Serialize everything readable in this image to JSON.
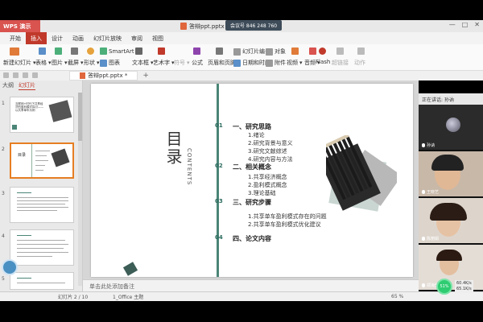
{
  "window": {
    "app_name": "WPS 演示",
    "doc_title": "答辩ppt.pptx",
    "share_label": "会议号 846 248 760",
    "controls": [
      "—",
      "□",
      "✕"
    ]
  },
  "menu": {
    "items": [
      "开始",
      "插入",
      "设计",
      "动画",
      "幻灯片放映",
      "审阅",
      "视图"
    ],
    "active_index": 1
  },
  "ribbon": {
    "new_slide": "新建幻灯片",
    "table": "表格",
    "picture": "图片",
    "screenshot": "截屏",
    "shape": "形状",
    "smartart": "SmartArt",
    "chart": "图表",
    "textbox": "文本框",
    "wordart": "艺术字",
    "symbol": "符号",
    "formula": "公式",
    "header_footer": "页眉和页脚",
    "slide_number": "幻灯片编号",
    "datetime": "日期和时间",
    "object": "对象",
    "attachment": "附件",
    "video": "视频",
    "audio": "音频",
    "flash": "Flash",
    "hyperlink": "超链接",
    "action": "动作"
  },
  "tabstrip": {
    "file_tab": "答辩ppt.pptx *",
    "plus": "+"
  },
  "left_panel": {
    "outline_tab": "大纲",
    "slides_tab": "幻灯片",
    "thumb_numbers": [
      "1",
      "2",
      "3",
      "4",
      "5"
    ],
    "thumb1_title": "互联网+时代下共享经济的盈利模式探讨——以共享单车为例",
    "thumb2_title": "目录"
  },
  "slide": {
    "title": "目录",
    "contents_label": "CONTENTS",
    "sections": [
      {
        "num": "01",
        "head": "一、研究思路"
      },
      {
        "num": "02",
        "head": "二、相关概念"
      },
      {
        "num": "03",
        "head": "三、研究步骤"
      },
      {
        "num": "04",
        "head": "四、论文内容"
      }
    ],
    "sub_items_1": [
      "1.绪论",
      "2.研究背景与意义",
      "3.研究文献综述",
      "4.研究内容与方法"
    ],
    "sub_items_2": [
      "1.共享经济概念",
      "2.盈利模式概念",
      "3.理论基础"
    ],
    "sub_items_3": [
      "1.共享单车盈利模式存在的问题",
      "2.共享单车盈利模式优化建议"
    ]
  },
  "notes": {
    "placeholder": "单击此处添加备注"
  },
  "right_panel": {
    "speaking_label": "正在讲话: 孙讷",
    "participants": [
      "孙讷",
      "王晓艺",
      "陈丽娟",
      "郑海莹"
    ]
  },
  "status": {
    "slide_counter": "幻灯片 2 / 10",
    "theme": "1_Office 主题",
    "zoom": "65 %"
  },
  "network": {
    "badge": "51%",
    "up": "60.4K/s",
    "down": "65.1K/s"
  }
}
